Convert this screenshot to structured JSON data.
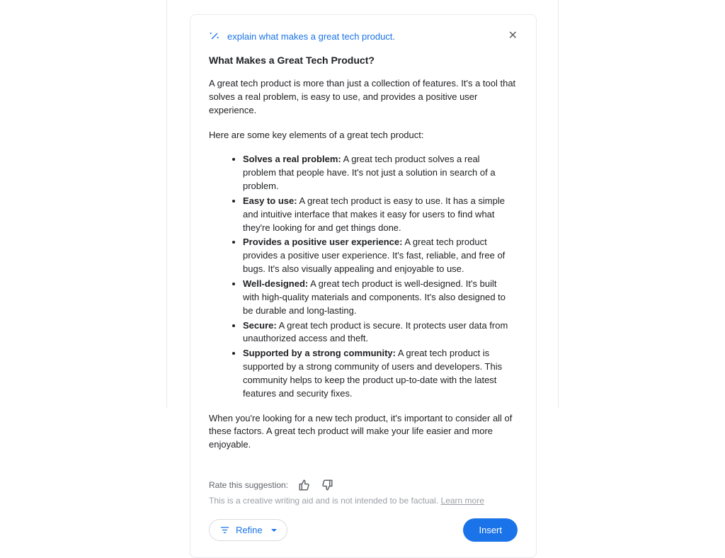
{
  "header": {
    "prompt": "explain what makes a great tech product."
  },
  "content": {
    "title": "What Makes a Great Tech Product?",
    "intro": "A great tech product is more than just a collection of features. It's a tool that solves a real problem, is easy to use, and provides a positive user experience.",
    "lead_in": "Here are some key elements of a great tech product:",
    "bullets": [
      {
        "bold": "Solves a real problem:",
        "text": " A great tech product solves a real problem that people have. It's not just a solution in search of a problem."
      },
      {
        "bold": "Easy to use:",
        "text": " A great tech product is easy to use. It has a simple and intuitive interface that makes it easy for users to find what they're looking for and get things done."
      },
      {
        "bold": "Provides a positive user experience:",
        "text": " A great tech product provides a positive user experience. It's fast, reliable, and free of bugs. It's also visually appealing and enjoyable to use."
      },
      {
        "bold": "Well-designed:",
        "text": " A great tech product is well-designed. It's built with high-quality materials and components. It's also designed to be durable and long-lasting."
      },
      {
        "bold": "Secure:",
        "text": " A great tech product is secure. It protects user data from unauthorized access and theft."
      },
      {
        "bold": "Supported by a strong community:",
        "text": " A great tech product is supported by a strong community of users and developers. This community helps to keep the product up-to-date with the latest features and security fixes."
      }
    ],
    "outro": "When you're looking for a new tech product, it's important to consider all of these factors. A great tech product will make your life easier and more enjoyable."
  },
  "rating": {
    "label": "Rate this suggestion:"
  },
  "disclaimer": {
    "text": "This is a creative writing aid and is not intended to be factual. ",
    "learn_more": "Learn more"
  },
  "actions": {
    "refine": "Refine",
    "insert": "Insert"
  }
}
